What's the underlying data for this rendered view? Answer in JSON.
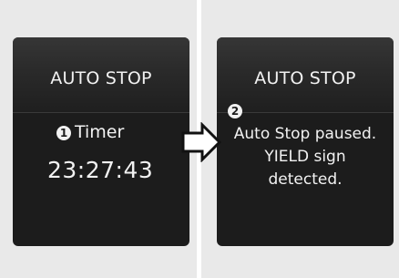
{
  "screens": [
    {
      "title": "AUTO STOP",
      "step_number": "1",
      "label": "Timer",
      "value": "23:27:43"
    },
    {
      "title": "AUTO STOP",
      "step_number": "2",
      "message_lines": [
        "Auto Stop paused.",
        "YIELD sign",
        "detected."
      ]
    }
  ],
  "transition_icon": "right-arrow-icon",
  "colors": {
    "screen_background": "#1c1c1c",
    "page_background": "#e9e9e9",
    "text": "#f2f2f2"
  }
}
